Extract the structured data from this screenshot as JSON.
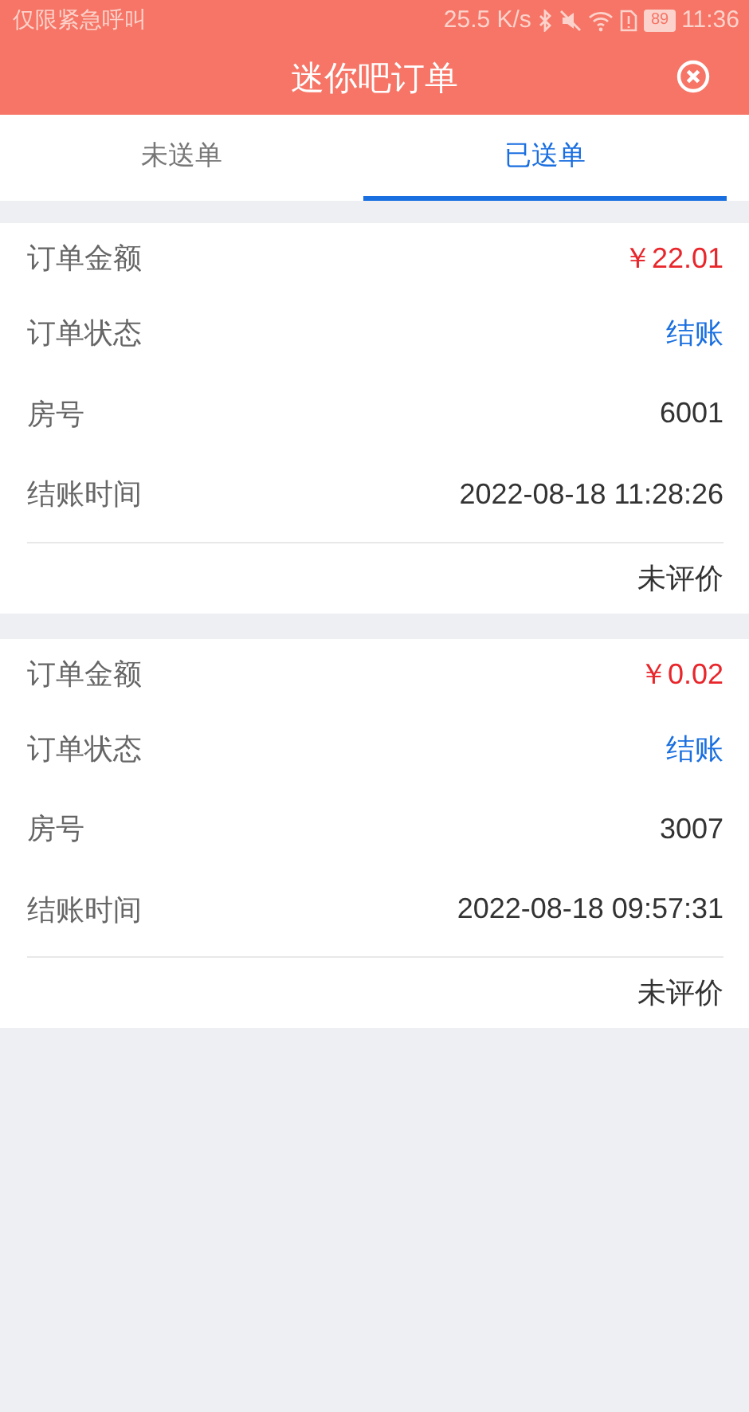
{
  "status_bar": {
    "carrier": "仅限紧急呼叫",
    "speed": "25.5 K/s",
    "battery": "89",
    "time": "11:36"
  },
  "header": {
    "title": "迷你吧订单"
  },
  "tabs": [
    {
      "label": "未送单",
      "selected": false
    },
    {
      "label": "已送单",
      "selected": true
    }
  ],
  "orders": [
    {
      "fields": [
        {
          "label": "订单金额",
          "value": "￥22.01",
          "kind": "amount"
        },
        {
          "label": "订单状态",
          "value": "结账",
          "kind": "status"
        },
        {
          "label": "房号",
          "value": "6001",
          "kind": "plain"
        },
        {
          "label": "结账时间",
          "value": "2022-08-18 11:28:26",
          "kind": "plain"
        }
      ],
      "rating": "未评价"
    },
    {
      "fields": [
        {
          "label": "订单金额",
          "value": "￥0.02",
          "kind": "amount"
        },
        {
          "label": "订单状态",
          "value": "结账",
          "kind": "status"
        },
        {
          "label": "房号",
          "value": "3007",
          "kind": "plain"
        },
        {
          "label": "结账时间",
          "value": "2022-08-18 09:57:31",
          "kind": "plain"
        }
      ],
      "rating": "未评价"
    }
  ]
}
